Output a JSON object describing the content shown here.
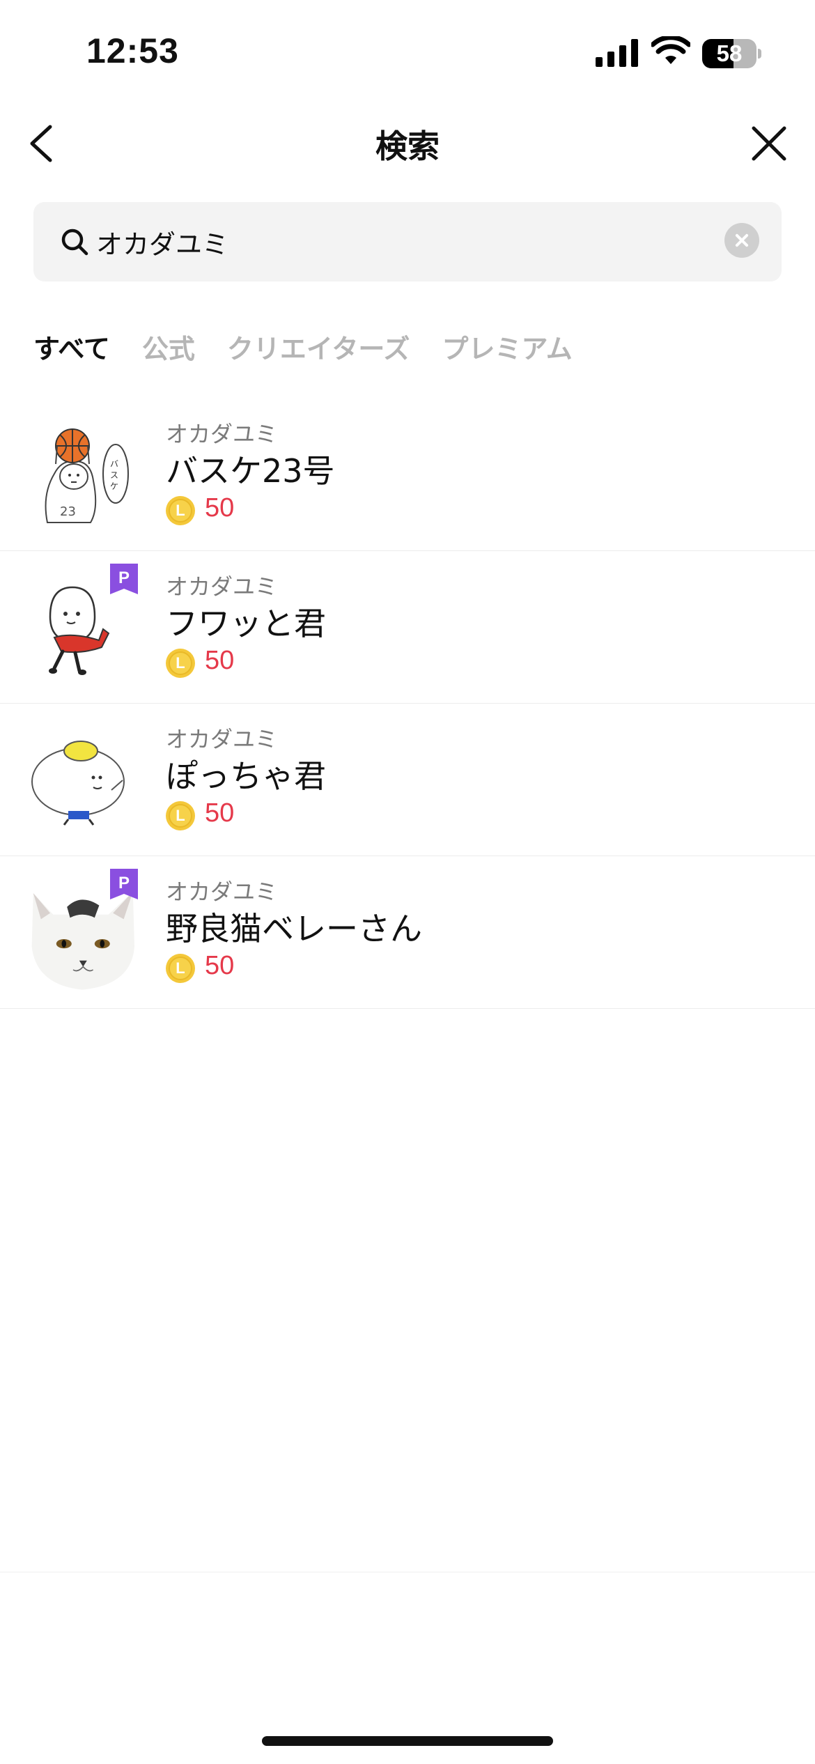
{
  "status_bar": {
    "time": "12:53",
    "battery_level": "58",
    "battery_fraction": 0.58,
    "icons": [
      "signal-icon",
      "wifi-icon",
      "battery-icon"
    ]
  },
  "header": {
    "title": "検索",
    "back_icon": "chevron-left-icon",
    "close_icon": "close-icon"
  },
  "search": {
    "value": "オカダユミ",
    "placeholder": "",
    "icon": "search-icon",
    "clear_icon": "clear-icon"
  },
  "tabs": [
    {
      "label": "すべて",
      "active": true
    },
    {
      "label": "公式",
      "active": false
    },
    {
      "label": "クリエイターズ",
      "active": false
    },
    {
      "label": "プレミアム",
      "active": false
    }
  ],
  "results": [
    {
      "author": "オカダユミ",
      "name": "バスケ23号",
      "price": "50",
      "premium": false,
      "thumb": "basketball-character"
    },
    {
      "author": "オカダユミ",
      "name": "フワッと君",
      "price": "50",
      "premium": true,
      "thumb": "ghost-character"
    },
    {
      "author": "オカダユミ",
      "name": "ぽっちゃ君",
      "price": "50",
      "premium": false,
      "thumb": "chubby-character"
    },
    {
      "author": "オカダユミ",
      "name": "野良猫ベレーさん",
      "price": "50",
      "premium": true,
      "thumb": "cat-photo"
    }
  ],
  "colors": {
    "price": "#e5394a",
    "coin": "#f4c83a",
    "premium_badge": "#8a4fe0",
    "tab_inactive": "#b5b5b5"
  },
  "premium_badge_label": "P",
  "coin_label": "L"
}
